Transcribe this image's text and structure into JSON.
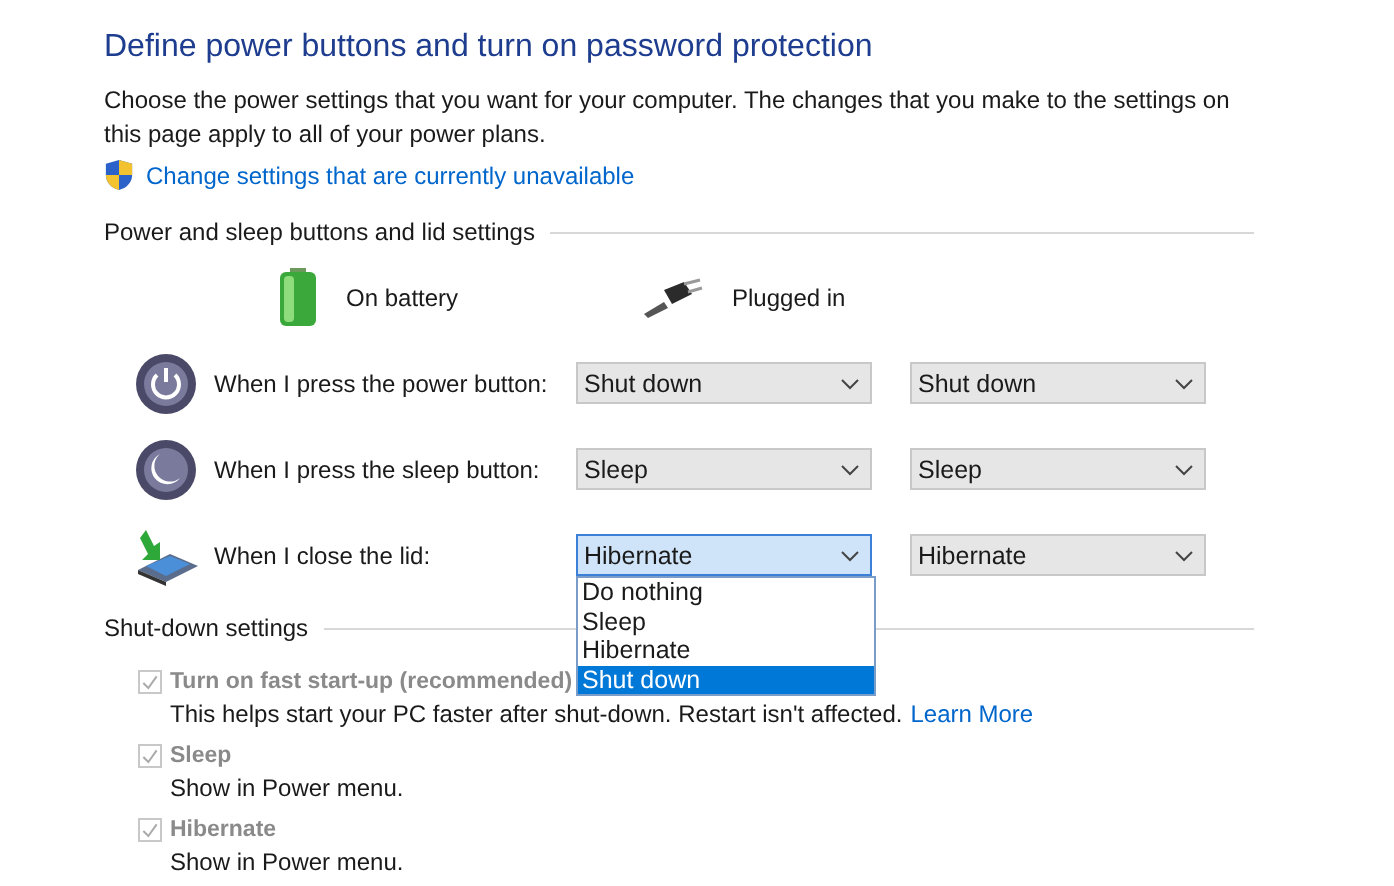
{
  "title": "Define power buttons and turn on password protection",
  "description": "Choose the power settings that you want for your computer. The changes that you make to the settings on this page apply to all of your power plans.",
  "admin_link": "Change settings that are currently unavailable",
  "buttons_section": {
    "heading": "Power and sleep buttons and lid settings",
    "columns": [
      {
        "kind": "battery",
        "label": "On battery"
      },
      {
        "kind": "plug",
        "label": "Plugged in"
      }
    ],
    "rows": [
      {
        "kind": "power",
        "label": "When I press the power button:",
        "battery": {
          "value": "Shut down",
          "open": false
        },
        "plugged": {
          "value": "Shut down"
        }
      },
      {
        "kind": "sleep",
        "label": "When I press the sleep button:",
        "battery": {
          "value": "Sleep",
          "open": false
        },
        "plugged": {
          "value": "Sleep"
        }
      },
      {
        "kind": "lid",
        "label": "When I close the lid:",
        "battery": {
          "value": "Hibernate",
          "open": true,
          "options": [
            {
              "label": "Do nothing",
              "highlighted": false
            },
            {
              "label": "Sleep",
              "highlighted": false
            },
            {
              "label": "Hibernate",
              "highlighted": false
            },
            {
              "label": "Shut down",
              "highlighted": true
            }
          ]
        },
        "plugged": {
          "value": "Hibernate"
        }
      }
    ]
  },
  "shutdown_section": {
    "heading": "Shut-down settings",
    "options": [
      {
        "label": "Turn on fast start-up (recommended)",
        "checked": true,
        "disabled": true,
        "description": "This helps start your PC faster after shut-down. Restart isn't affected.",
        "link": "Learn More"
      },
      {
        "label": "Sleep",
        "checked": true,
        "disabled": true,
        "description": "Show in Power menu."
      },
      {
        "label": "Hibernate",
        "checked": true,
        "disabled": true,
        "description": "Show in Power menu."
      }
    ]
  }
}
